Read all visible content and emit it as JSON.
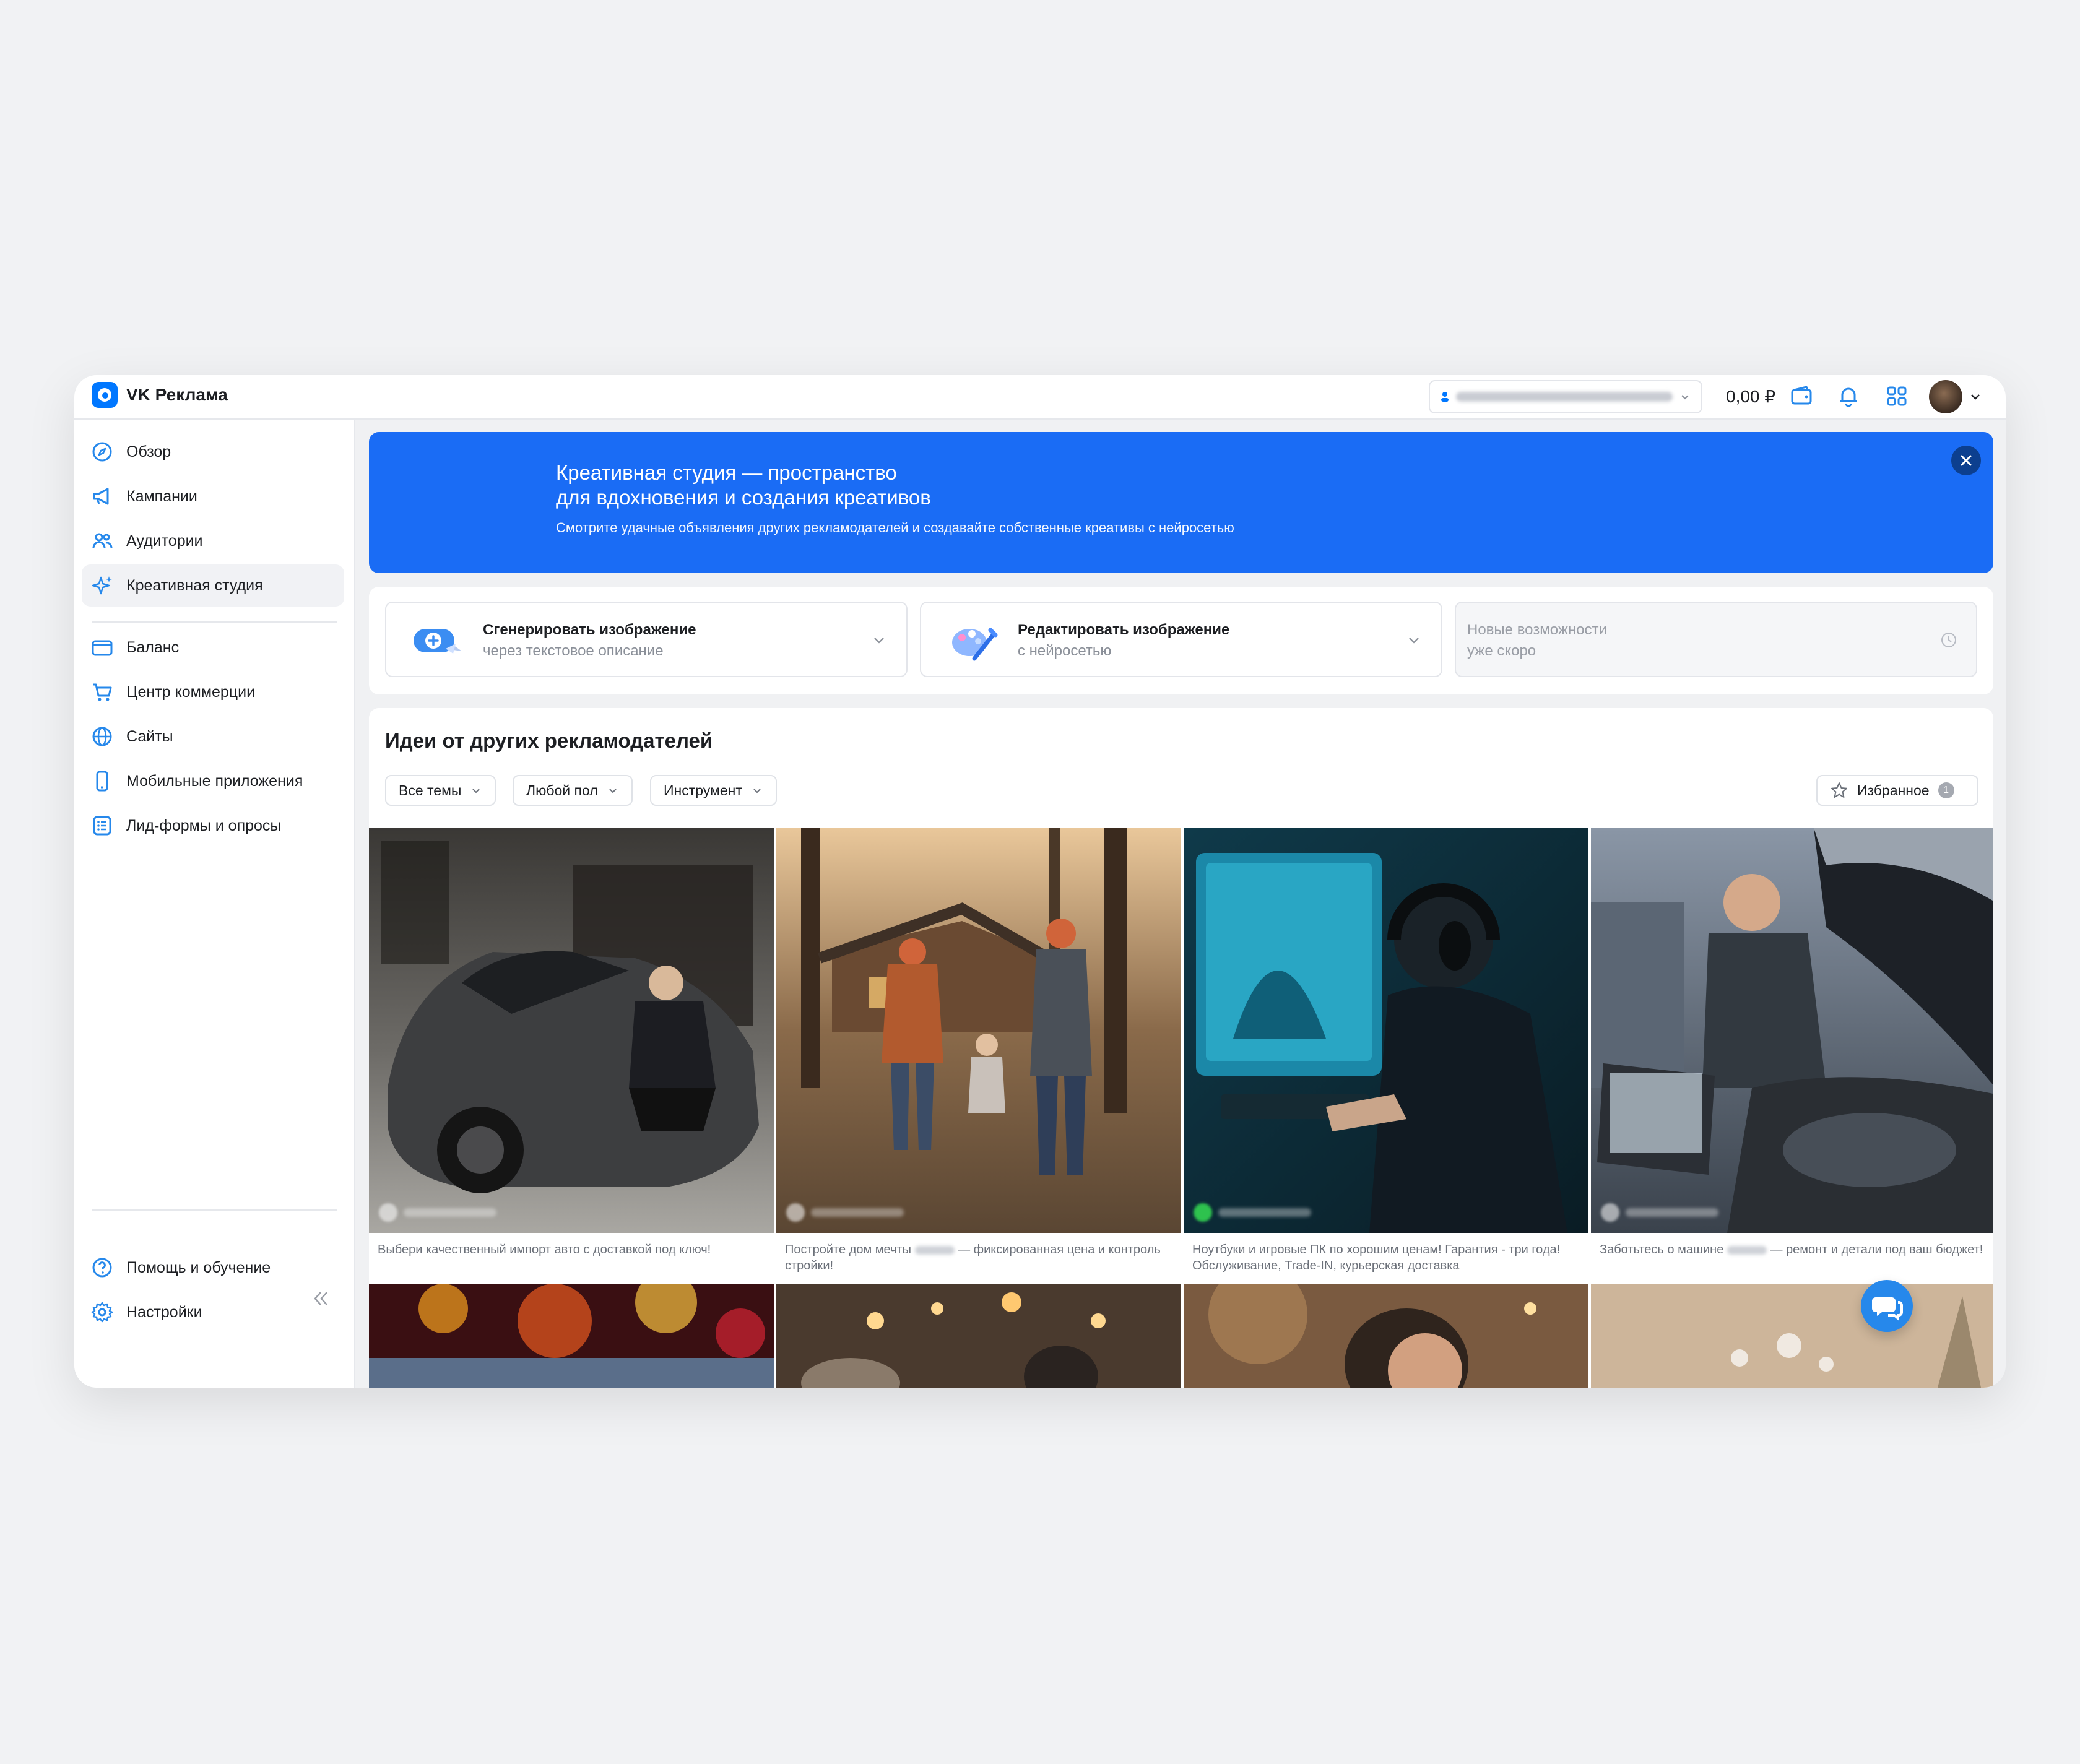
{
  "header": {
    "logo_text": "VK Реклама",
    "balance": "0,00 ₽",
    "icons": [
      "wallet-icon",
      "bell-icon",
      "apps-grid-icon",
      "chevron-down-icon"
    ]
  },
  "sidebar": {
    "items": [
      {
        "label": "Обзор",
        "icon": "compass-icon"
      },
      {
        "label": "Кампании",
        "icon": "megaphone-icon"
      },
      {
        "label": "Аудитории",
        "icon": "users-icon"
      },
      {
        "label": "Креативная студия",
        "icon": "sparkle-icon",
        "active": true
      },
      {
        "label": "Баланс",
        "icon": "wallet-icon"
      },
      {
        "label": "Центр коммерции",
        "icon": "cart-icon"
      },
      {
        "label": "Сайты",
        "icon": "globe-icon"
      },
      {
        "label": "Мобильные приложения",
        "icon": "phone-icon"
      },
      {
        "label": "Лид-формы и опросы",
        "icon": "form-icon"
      }
    ],
    "bottom": [
      {
        "label": "Помощь и обучение",
        "icon": "help-icon"
      },
      {
        "label": "Настройки",
        "icon": "gear-icon"
      }
    ]
  },
  "banner": {
    "title_line1": "Креативная студия — пространство",
    "title_line2": "для вдохновения и создания креативов",
    "subtitle": "Смотрите удачные объявления других рекламодателей и создавайте собственные креативы с нейросетью"
  },
  "tools": [
    {
      "title": "Сгенерировать изображение",
      "subtitle": "через текстовое описание"
    },
    {
      "title": "Редактировать изображение",
      "subtitle": "с нейросетью"
    },
    {
      "title": "Новые возможности",
      "subtitle": "уже скоро"
    }
  ],
  "ideas": {
    "title": "Идеи от других рекламодателей",
    "filters": [
      "Все темы",
      "Любой пол",
      "Инструмент"
    ],
    "favorites_label": "Избранное",
    "favorites_count": "1",
    "cards": [
      {
        "text": "Выбери качественный импорт авто с доставкой под ключ!"
      },
      {
        "text_before": "Постройте дом мечты",
        "text_after": "— фиксированная цена и контроль стройки!"
      },
      {
        "text": "Ноутбуки и игровые ПК по хорошим ценам! Гарантия - три года! Обслуживание, Trade-IN, курьерская доставка"
      },
      {
        "text_before": "Заботьтесь о машине",
        "text_after": "— ремонт и детали под ваш бюджет!"
      }
    ]
  },
  "colors": {
    "accent": "#0077ff",
    "banner": "#1a6cf5",
    "page_bg": "#f1f2f4"
  }
}
